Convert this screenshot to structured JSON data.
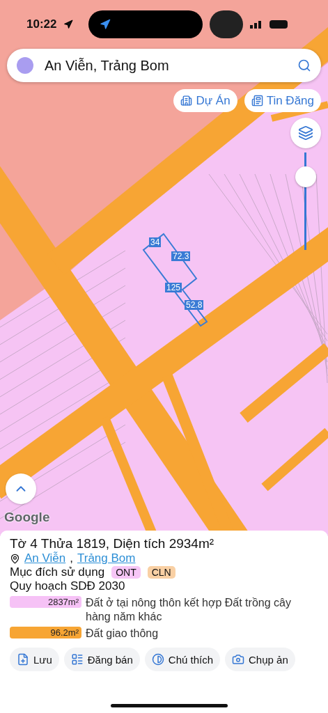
{
  "status_bar": {
    "time": "10:22"
  },
  "search": {
    "value": "An Viễn, Trảng Bom"
  },
  "chips": [
    {
      "kind": "project",
      "label": "Dự Án"
    },
    {
      "kind": "listing",
      "label": "Tin Đăng"
    }
  ],
  "zoom_slider": {
    "level": 0.82
  },
  "plot": {
    "edges": [
      {
        "label": "34"
      },
      {
        "label": "72.3"
      },
      {
        "label": "125"
      },
      {
        "label": "52.8"
      }
    ]
  },
  "map_attribution": "Google",
  "info": {
    "title": "Tờ 4 Thửa 1819, Diện tích 2934m²",
    "location": [
      {
        "label": "An Viễn"
      },
      {
        "label": "Trảng Bom"
      }
    ],
    "location_separator": ",",
    "usage_label": "Mục đích sử dụng",
    "usage_tags": [
      {
        "label": "ONT",
        "color": "#f6c6f6"
      },
      {
        "label": "CLN",
        "color": "#f9d0a4"
      }
    ],
    "plan_title": "Quy hoạch SDĐ 2030",
    "legend": [
      {
        "area": "2837m²",
        "description": "Đất ở tại nông thôn kết hợp Đất trồng cây hàng năm khác",
        "color": "#f6c2f6"
      },
      {
        "area": "96.2m²",
        "description": "Đất giao thông",
        "color": "#f7a534"
      }
    ]
  },
  "actions": [
    {
      "kind": "save",
      "label": "Lưu"
    },
    {
      "kind": "post",
      "label": "Đăng bán"
    },
    {
      "kind": "legend",
      "label": "Chú thích"
    },
    {
      "kind": "capture",
      "label": "Chụp ản"
    }
  ]
}
